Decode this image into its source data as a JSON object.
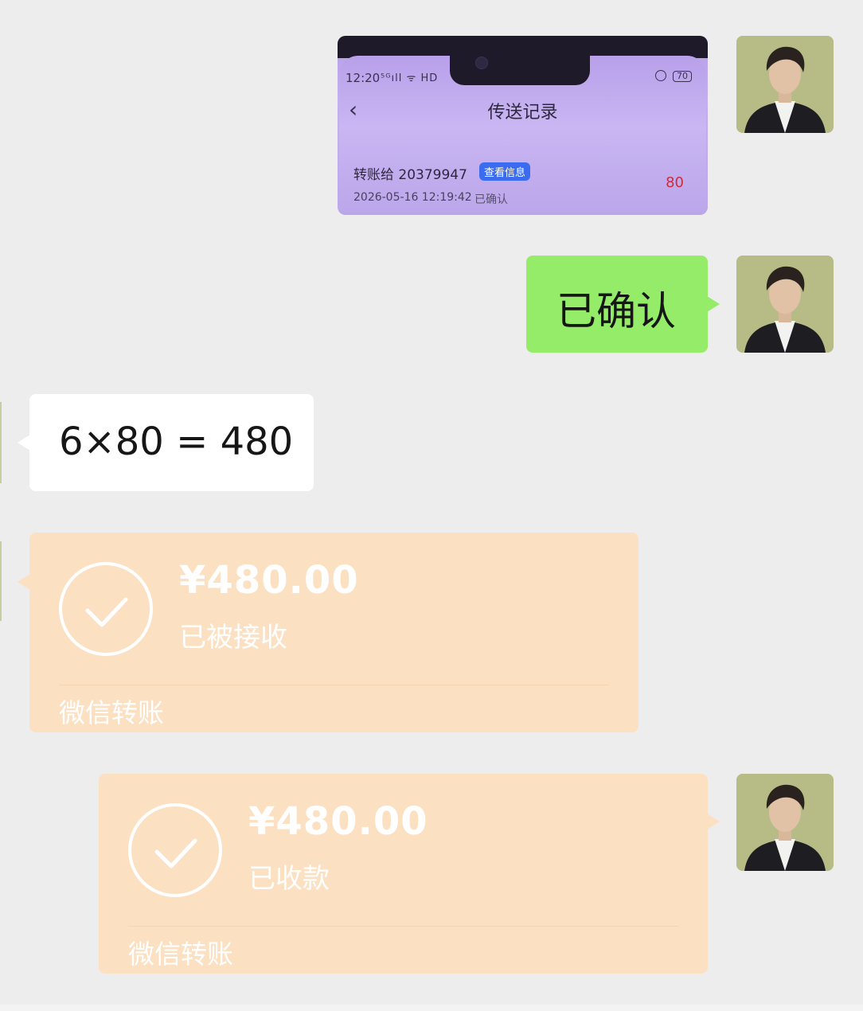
{
  "screenshot_message": {
    "status_time": "12:20",
    "status_signal": "⁵ᴳıll ᯤ HD",
    "battery": "70",
    "title": "传送记录",
    "back_icon": "chevron-left-icon",
    "transfer_to": "转账给 20379947",
    "view_button": "查看信息",
    "amount": "80",
    "datetime": "2026-05-16 12:19:42",
    "status": "已确认"
  },
  "sent_text": "已确认",
  "received_text": "6×80 = 480",
  "transfer_received": {
    "amount": "¥480.00",
    "status": "已被接收",
    "footer": "微信转账"
  },
  "transfer_sent": {
    "amount": "¥480.00",
    "status": "已收款",
    "footer": "微信转账"
  },
  "colors": {
    "background": "#ededed",
    "green_bubble": "#95ec69",
    "transfer_card": "#fce0c2"
  }
}
